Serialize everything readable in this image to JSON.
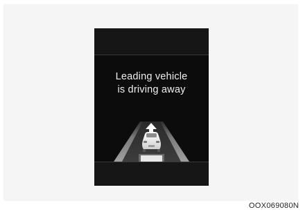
{
  "display": {
    "message_line1": "Leading vehicle",
    "message_line2": "is driving away",
    "icons": [
      "arrow-up-icon",
      "leading-vehicle-icon",
      "own-vehicle-icon",
      "road-icon"
    ]
  },
  "caption": "OOX069080N",
  "colors": {
    "frame_background": "#f5f5f5",
    "screen_background": "#0c0c0c",
    "text": "#f0f0f0",
    "road_edge": "#8a8a8a"
  }
}
